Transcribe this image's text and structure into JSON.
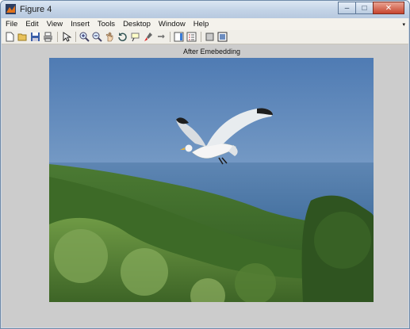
{
  "window": {
    "title": "Figure 4",
    "minimize_glyph": "–",
    "maximize_glyph": "□",
    "close_glyph": "✕"
  },
  "menu": {
    "items": [
      "File",
      "Edit",
      "View",
      "Insert",
      "Tools",
      "Desktop",
      "Window",
      "Help"
    ]
  },
  "toolbar": {
    "icons": [
      "new-figure-icon",
      "open-file-icon",
      "save-icon",
      "print-icon",
      "edit-plot-arrow-icon",
      "zoom-in-icon",
      "zoom-out-icon",
      "pan-icon",
      "rotate-3d-icon",
      "data-cursor-icon",
      "brush-icon",
      "link-plot-icon",
      "insert-colorbar-icon",
      "insert-legend-icon",
      "hide-plot-tools-icon",
      "show-plot-tools-icon"
    ]
  },
  "axes": {
    "title": "After Emebedding"
  },
  "colors": {
    "sky": "#6e95c2",
    "sea": "#4f78a4",
    "hills": "#3f6b28",
    "figure_bg": "#cccccc"
  }
}
